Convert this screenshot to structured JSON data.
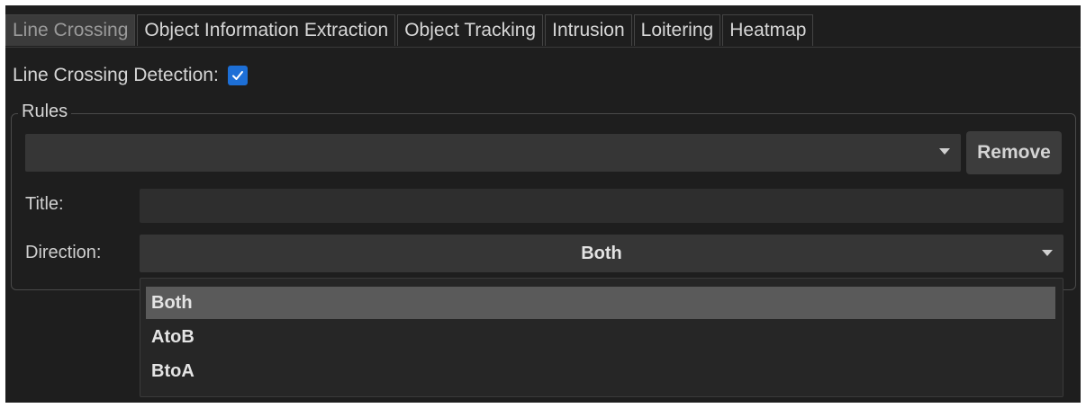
{
  "tabs": [
    {
      "label": "Line Crossing",
      "active": true
    },
    {
      "label": "Object Information Extraction",
      "active": false
    },
    {
      "label": "Object Tracking",
      "active": false
    },
    {
      "label": "Intrusion",
      "active": false
    },
    {
      "label": "Loitering",
      "active": false
    },
    {
      "label": "Heatmap",
      "active": false
    }
  ],
  "detection": {
    "label": "Line Crossing Detection:",
    "checked": true
  },
  "rules": {
    "legend": "Rules",
    "selected_rule": "",
    "remove_label": "Remove",
    "title_label": "Title:",
    "title_value": "",
    "direction_label": "Direction:",
    "direction_value": "Both",
    "direction_options": [
      "Both",
      "AtoB",
      "BtoA"
    ],
    "highlighted_option": "Both"
  },
  "colors": {
    "background": "#1e1e1e",
    "checkbox_accent": "#1d6fd6",
    "highlight": "#5a5a5a"
  },
  "icons": {
    "dropdown_arrow": "chevron-down-icon",
    "checkbox_check": "check-icon"
  }
}
